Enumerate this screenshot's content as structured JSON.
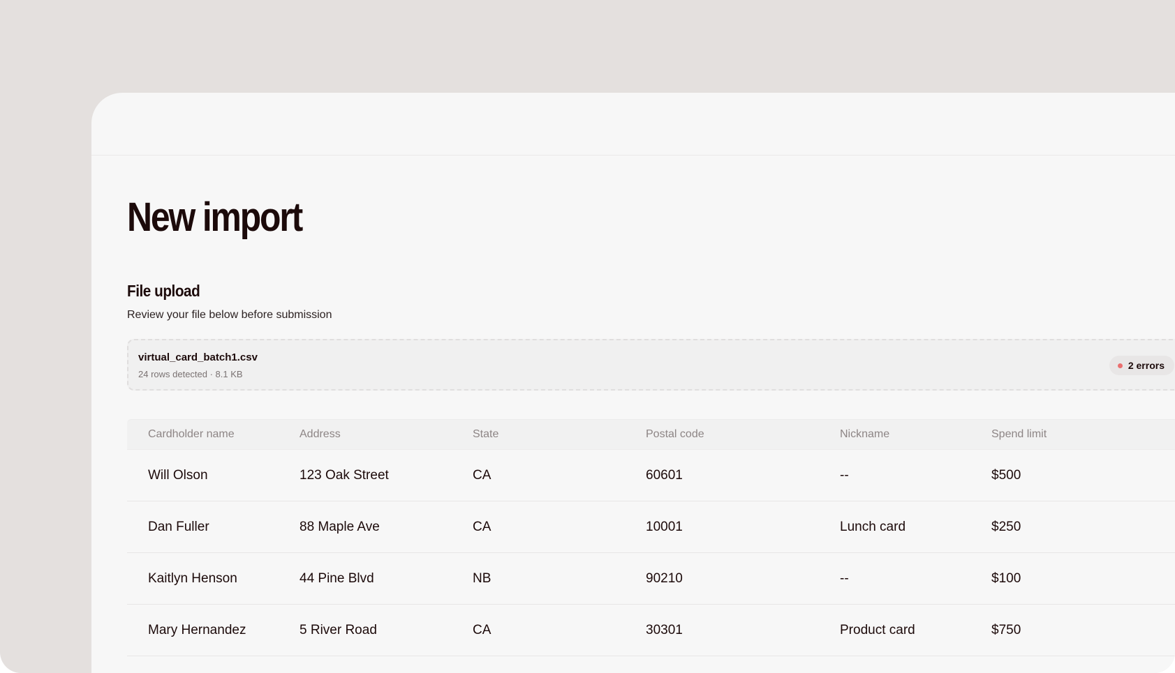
{
  "page": {
    "title": "New import"
  },
  "upload": {
    "section_title": "File upload",
    "subtitle": "Review your file below before submission",
    "file_name": "virtual_card_batch1.csv",
    "file_meta": "24 rows detected · 8.1 KB",
    "error_badge": "2 errors",
    "error_color": "#ea6f6f"
  },
  "table": {
    "columns": [
      "Cardholder name",
      "Address",
      "State",
      "Postal code",
      "Nickname",
      "Spend limit"
    ],
    "rows": [
      [
        "Will Olson",
        "123 Oak Street",
        "CA",
        "60601",
        "--",
        "$500"
      ],
      [
        "Dan Fuller",
        "88 Maple Ave",
        "CA",
        "10001",
        "Lunch card",
        "$250"
      ],
      [
        "Kaitlyn Henson",
        "44 Pine Blvd",
        "NB",
        "90210",
        "--",
        "$100"
      ],
      [
        "Mary Hernandez",
        "5 River Road",
        "CA",
        "30301",
        "Product card",
        "$750"
      ]
    ]
  }
}
